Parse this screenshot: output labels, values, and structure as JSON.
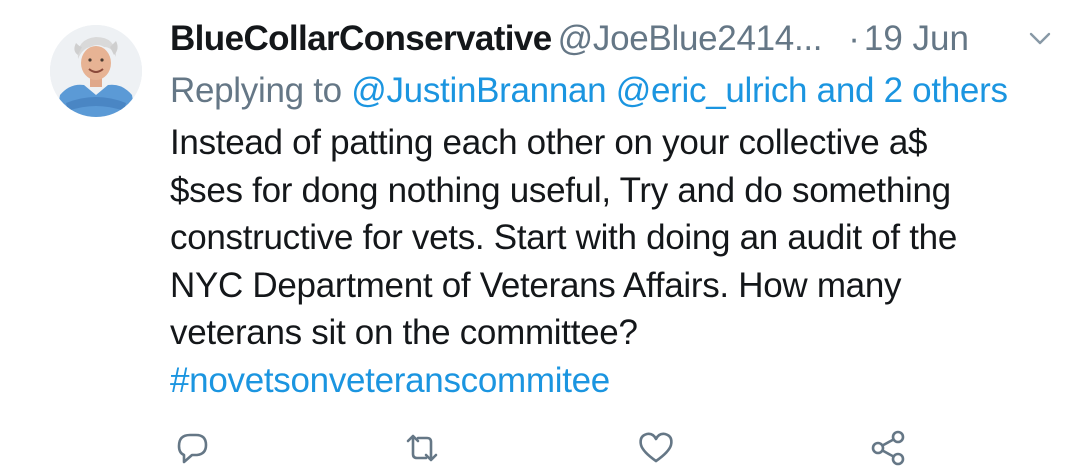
{
  "tweet": {
    "author_name": "BlueCollarConservative",
    "author_handle": "@JoeBlue2414...",
    "separator": "·",
    "date": "19 Jun",
    "reply": {
      "prefix": "Replying to",
      "mention_1": "@JustinBrannan",
      "mention_2": "@eric_ulrich",
      "others": "and 2 others"
    },
    "text_lines": [
      "Instead of patting each other on your collective a$",
      "$ses for dong nothing useful, Try and do something",
      "constructive for vets. Start with doing an audit of the",
      "NYC Department of Veterans Affairs. How many",
      "veterans sit on the committee?"
    ],
    "hashtag": "#novetsonveteranscommitee"
  },
  "icons": {
    "avatar": "profile-photo",
    "menu": "chevron-down-icon",
    "reply": "reply-icon",
    "retweet": "retweet-icon",
    "like": "heart-icon",
    "share": "share-icon"
  },
  "colors": {
    "primary_text": "#14171a",
    "secondary_text": "#657786",
    "link": "#1b95e0",
    "icon": "#657786"
  }
}
